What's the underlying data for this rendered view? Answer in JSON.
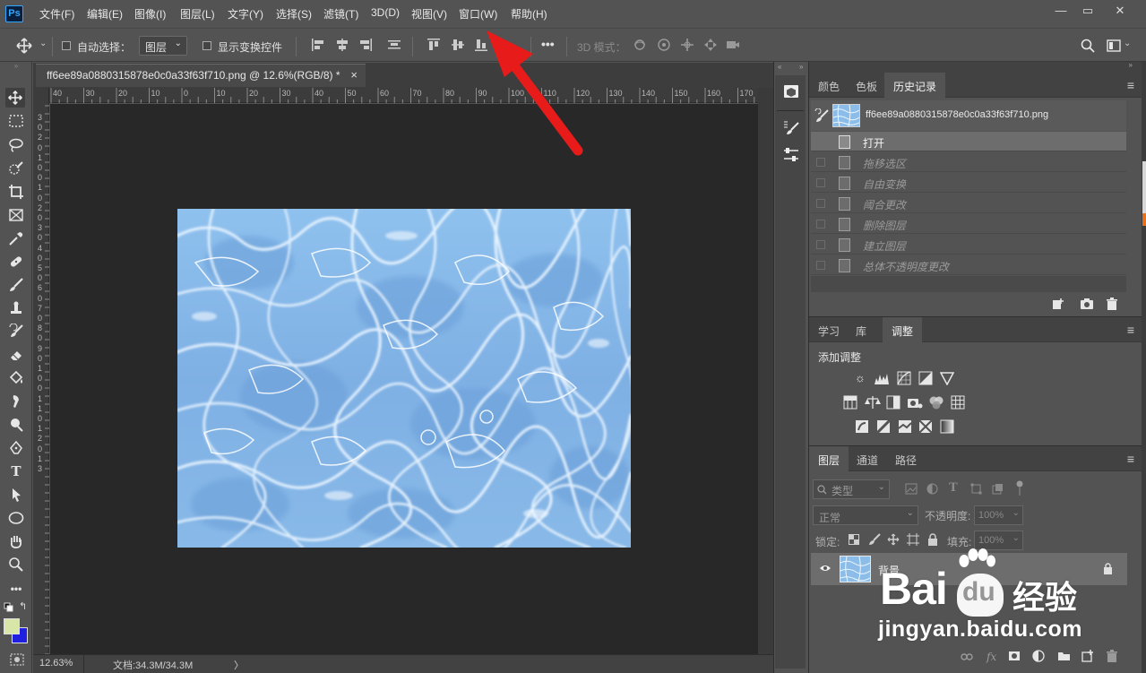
{
  "app": {
    "logo_text": "Ps"
  },
  "menu": [
    "文件(F)",
    "编辑(E)",
    "图像(I)",
    "图层(L)",
    "文字(Y)",
    "选择(S)",
    "滤镜(T)",
    "3D(D)",
    "视图(V)",
    "窗口(W)",
    "帮助(H)"
  ],
  "window_controls": {
    "minimize": "—",
    "restore": "▭",
    "close": "✕"
  },
  "options": {
    "auto_select_label": "自动选择：",
    "layer_select_value": "图层",
    "show_transform_label": "显示变换控件",
    "more": "•••",
    "mode3d_label": "3D 模式："
  },
  "document": {
    "tab_title": "ff6ee89a0880315878e0c0a33f63f710.png @ 12.6%(RGB/8) *",
    "close_icon": "×",
    "ruler_h_labels": [
      "40",
      "30",
      "20",
      "10",
      "0",
      "10",
      "20",
      "30",
      "40",
      "50",
      "60",
      "70",
      "80",
      "90",
      "100",
      "110",
      "120",
      "130",
      "140",
      "150",
      "160",
      "170"
    ],
    "ruler_v_labels": [
      "3",
      "0",
      "2",
      "0",
      "1",
      "0",
      "0",
      "1",
      "0",
      "2",
      "0",
      "3",
      "0",
      "4",
      "0",
      "5",
      "0",
      "6",
      "0",
      "7",
      "0",
      "8",
      "0",
      "9",
      "0",
      "1",
      "0",
      "0",
      "1",
      "1",
      "0",
      "1",
      "2",
      "0",
      "1",
      "3"
    ]
  },
  "status": {
    "zoom": "12.63%",
    "doc_info": "文档:34.3M/34.3M",
    "arrow": "〉"
  },
  "panels": {
    "top_tabs": [
      "颜色",
      "色板",
      "历史记录"
    ],
    "history": {
      "snapshot_name": "ff6ee89a0880315878e0c0a33f63f710.png",
      "items": [
        "打开",
        "拖移选区",
        "自由变换",
        "阈合更改",
        "删除图层",
        "建立图层",
        "总体不透明度更改"
      ]
    },
    "mid_tabs": [
      "学习",
      "库",
      "调整"
    ],
    "adjust_title": "添加调整",
    "layers_tabs": [
      "图层",
      "通道",
      "路径"
    ],
    "layers": {
      "filter_kind": "类型",
      "blend_mode": "正常",
      "opacity_label": "不透明度:",
      "opacity_value": "100%",
      "lock_label": "锁定:",
      "fill_label": "填充:",
      "fill_value": "100%",
      "layer_name": "背景"
    }
  },
  "watermark": {
    "brand": "Bai",
    "brand2": "du",
    "cn": "经验",
    "url": "jingyan.baidu.com"
  },
  "colors": {
    "annotation_arrow": "#e81b1b",
    "foreground": "#d8e6a8",
    "background": "#1f1fe0"
  }
}
